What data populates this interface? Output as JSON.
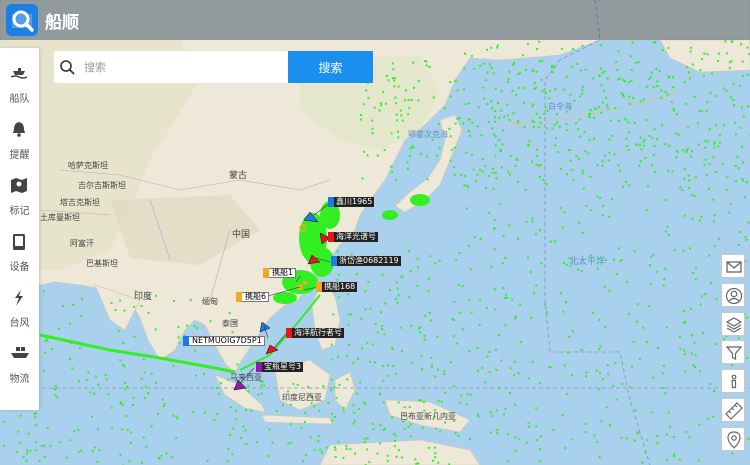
{
  "app": {
    "title": "船顺"
  },
  "search": {
    "placeholder": "搜索",
    "button_label": "搜索"
  },
  "sidebar": {
    "items": [
      {
        "label": "船队",
        "icon": "fleet-icon"
      },
      {
        "label": "提醒",
        "icon": "bell-icon"
      },
      {
        "label": "标记",
        "icon": "map-mark-icon"
      },
      {
        "label": "设备",
        "icon": "tablet-icon"
      },
      {
        "label": "台风",
        "icon": "typhoon-icon"
      },
      {
        "label": "物流",
        "icon": "cargo-ship-icon"
      }
    ]
  },
  "toolbar": {
    "items": [
      {
        "name": "message-icon"
      },
      {
        "name": "user-icon"
      },
      {
        "name": "layers-icon"
      },
      {
        "name": "filter-icon"
      },
      {
        "name": "info-icon"
      },
      {
        "name": "ruler-icon"
      },
      {
        "name": "location-pin-icon"
      }
    ]
  },
  "map_labels": [
    "哈萨克斯坦",
    "吉尔吉斯斯坦",
    "塔吉克斯坦",
    "土库曼斯坦",
    "阿富汗",
    "巴基斯坦",
    "印度",
    "蒙古",
    "中国",
    "缅甸",
    "泰国",
    "马来西亚",
    "印度尼西亚",
    "巴布亚新几内亚",
    "北太平洋",
    "鄂霍次克海",
    "白令海"
  ],
  "ships": [
    {
      "name": "鑫川1965",
      "color": "#1e7ae8"
    },
    {
      "name": "海洋光谱号",
      "color": "#e8161b"
    },
    {
      "name": "浙岱渔0682119",
      "color": "#1e7ae8"
    },
    {
      "name": "携船1",
      "color": "#f5a623"
    },
    {
      "name": "携船168",
      "color": "#f5a623"
    },
    {
      "name": "携船6",
      "color": "#f5a623"
    },
    {
      "name": "海洋航行者号",
      "color": "#e8161b"
    },
    {
      "name": "NETMUOIG7D5P1",
      "color": "#1e7ae8"
    },
    {
      "name": "宝瓶星号3",
      "color": "#8b1ea8"
    }
  ],
  "colors": {
    "accent": "#1b8ff0",
    "ocean": "#a9d0ec",
    "land": "#e9e4d6",
    "vessel_dot": "#33ee22"
  }
}
